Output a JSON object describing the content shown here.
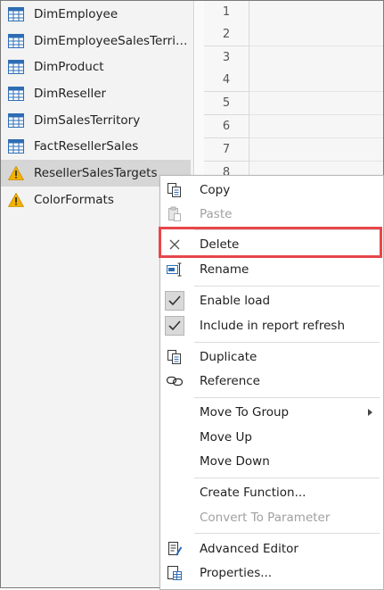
{
  "colors": {
    "highlight": "#e8474a",
    "warning": "#f2b200",
    "table_icon": "#2e6db4",
    "selected_row": "#d6d6d6"
  },
  "queries": [
    {
      "label": "DimEmployee",
      "icon": "table-icon",
      "selected": false
    },
    {
      "label": "DimEmployeeSalesTerrit...",
      "icon": "table-icon",
      "selected": false
    },
    {
      "label": "DimProduct",
      "icon": "table-icon",
      "selected": false
    },
    {
      "label": "DimReseller",
      "icon": "table-icon",
      "selected": false
    },
    {
      "label": "DimSalesTerritory",
      "icon": "table-icon",
      "selected": false
    },
    {
      "label": "FactResellerSales",
      "icon": "table-icon",
      "selected": false
    },
    {
      "label": "ResellerSalesTargets",
      "icon": "warning-icon",
      "selected": true
    },
    {
      "label": "ColorFormats",
      "icon": "warning-icon",
      "selected": false
    }
  ],
  "grid_rows": [
    "1",
    "2",
    "3",
    "4",
    "5",
    "6",
    "7",
    "8"
  ],
  "context_menu": {
    "copy": "Copy",
    "paste": "Paste",
    "delete": "Delete",
    "rename": "Rename",
    "enable_load": "Enable load",
    "include_refresh": "Include in report refresh",
    "duplicate": "Duplicate",
    "reference": "Reference",
    "move_to_group": "Move To Group",
    "move_up": "Move Up",
    "move_down": "Move Down",
    "create_function": "Create Function...",
    "convert_to_parameter": "Convert To Parameter",
    "advanced_editor": "Advanced Editor",
    "properties": "Properties..."
  }
}
